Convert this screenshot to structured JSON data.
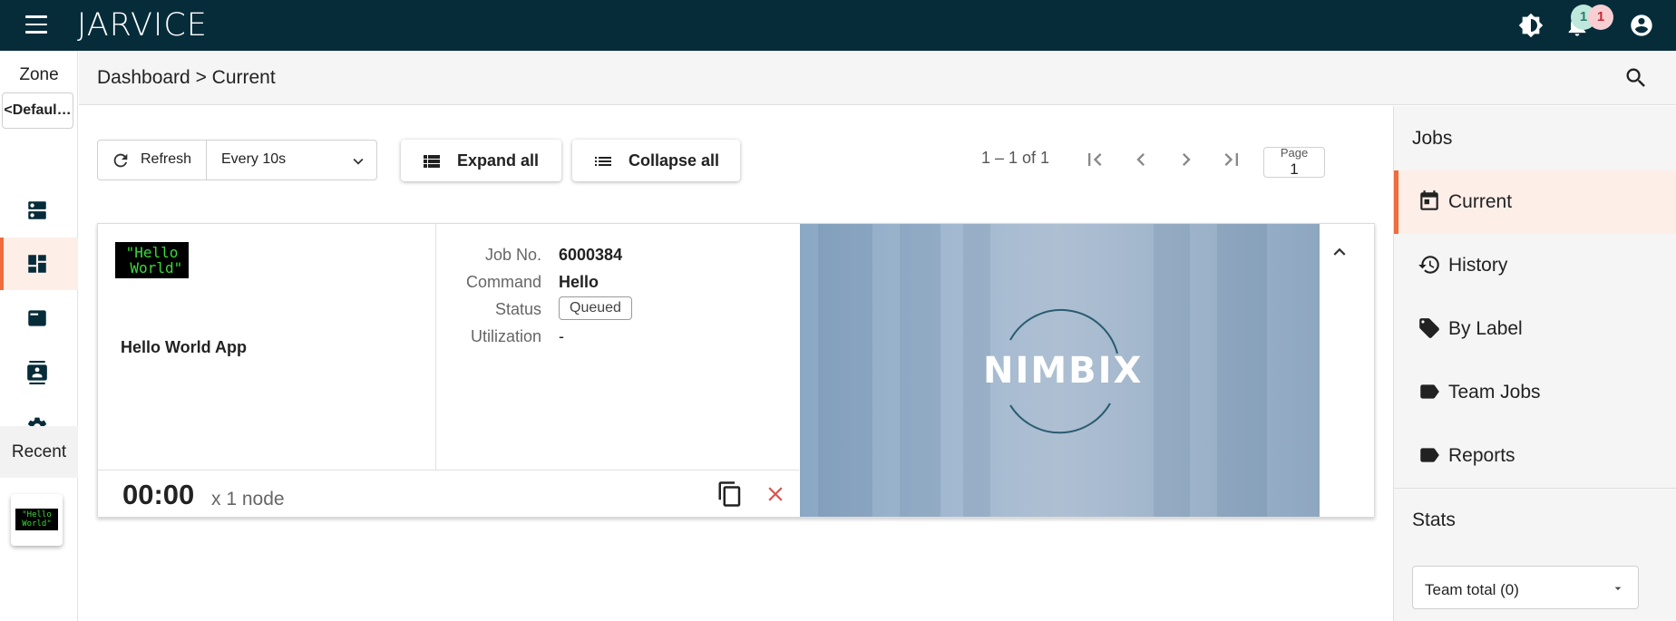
{
  "app": {
    "brand": "JARVICE"
  },
  "topbar": {
    "notifications_badge_a": "1",
    "notifications_badge_b": "1"
  },
  "leftrail": {
    "zone_label": "Zone",
    "zone_value": "<Defaul…",
    "recent_label": "Recent",
    "recent_app_text": "\"Hello\nWorld\""
  },
  "breadcrumb": {
    "text": "Dashboard > Current"
  },
  "toolbar": {
    "refresh_label": "Refresh",
    "interval_value": "Every 10s",
    "expand_label": "Expand all",
    "collapse_label": "Collapse all"
  },
  "pager": {
    "range": "1 – 1 of 1",
    "page_label": "Page",
    "page_value": "1"
  },
  "job": {
    "app_logo_text": "\"Hello\n World\"",
    "app_name": "Hello World App",
    "fields": {
      "job_no_label": "Job No.",
      "job_no_value": "6000384",
      "command_label": "Command",
      "command_value": "Hello",
      "status_label": "Status",
      "status_value": "Queued",
      "utilization_label": "Utilization",
      "utilization_value": "-"
    },
    "timer": "00:00",
    "nodes": "x 1 node",
    "preview_brand": "NIMBIX"
  },
  "rightpanel": {
    "jobs_header": "Jobs",
    "items": [
      {
        "label": "Current",
        "icon": "calendar-icon",
        "active": true
      },
      {
        "label": "History",
        "icon": "history-icon",
        "active": false
      },
      {
        "label": "By Label",
        "icon": "tag-icon",
        "active": false
      },
      {
        "label": "Team Jobs",
        "icon": "label-icon",
        "active": false
      },
      {
        "label": "Reports",
        "icon": "label-icon",
        "active": false
      }
    ],
    "stats_header": "Stats",
    "team_select_value": "Team total (0)"
  },
  "colors": {
    "topbar": "#062c3a",
    "accent": "#f26b3a",
    "active_bg": "#fdeee8",
    "cancel": "#d9534f"
  }
}
